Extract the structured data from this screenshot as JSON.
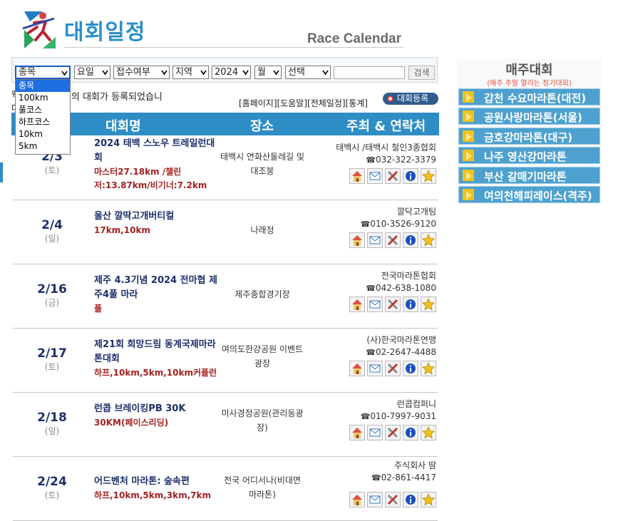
{
  "header": {
    "title": "대회일정",
    "subtitle": "Race Calendar"
  },
  "search": {
    "selects": {
      "event": "종목",
      "day": "요일",
      "registration": "접수여부",
      "region": "지역",
      "year": "2024",
      "month": "월",
      "pick": "선택"
    },
    "input_value": "",
    "button": "검색",
    "dropdown_options": [
      "종목",
      "100km",
      "풀코스",
      "하프코스",
      "10km",
      "5km"
    ]
  },
  "notice": {
    "left1": "웨",
    "left2": "다",
    "text": "의 대회가 등록되었습니"
  },
  "links": {
    "home": "[홈페이지]",
    "help": "[도움말]",
    "all": "[전체일정]",
    "stats": "[통계]",
    "register": "대회등록"
  },
  "table": {
    "headers": {
      "date": "",
      "name": "대회명",
      "place": "장소",
      "host": "주최 & 연락처"
    },
    "rows": [
      {
        "date": "2/3",
        "dow": "(토)",
        "name": "2024 태백 스노우 트레일런대회",
        "distance": "마스터27.18km /챌린저:13.87km/비기너:7.2km",
        "place": "태백시 연화산둘레길 및 대조붕",
        "org": "태백시 /태백시 철인3종협회",
        "tel": "032-322-3379"
      },
      {
        "date": "2/4",
        "dow": "(일)",
        "name": "울산 깔딱고개버티컬",
        "distance": "17km,10km",
        "place": "나래정",
        "org": "깔닥고개팀",
        "tel": "010-3526-9120"
      },
      {
        "date": "2/16",
        "dow": "(금)",
        "name": "제주 4.3기념 2024 전마협 제주4풀 마라",
        "distance": "풀",
        "place": "제주종합경기장",
        "org": "전국마라톤협회",
        "tel": "042-638-1080"
      },
      {
        "date": "2/17",
        "dow": "(토)",
        "name": "제21회 희망드림 동계국제마라톤대회",
        "distance": "하프,10km,5km,10km커플런",
        "place": "여의도한강공원 이벤트광장",
        "org": "(사)한국마라톤연맹",
        "tel": "02-2647-4488"
      },
      {
        "date": "2/18",
        "dow": "(일)",
        "name": "런콥 브레이킹PB 30K",
        "distance": "30KM(페이스리딩)",
        "place": "미사경정공원(관리동광장)",
        "org": "런콥컴퍼니",
        "tel": "010-7997-9031"
      },
      {
        "date": "2/24",
        "dow": "(토)",
        "name": "어드벤처 마라톤: 숲속편",
        "distance": "하프,10km,5km,3km,7km",
        "place": "전국 어디서나(비대면 마라톤)",
        "org": "주식회사 땀",
        "tel": "02-861-4417"
      }
    ],
    "icon_names": [
      "home-icon",
      "mail-icon",
      "tools-icon",
      "info-icon",
      "star-icon"
    ]
  },
  "weekly": {
    "title": "매주대회",
    "subtitle": "(매주 주말 열리는 정기대회)",
    "items": [
      "갑천 수요마라톤(대전)",
      "공원사랑마라톤(서울)",
      "금호강마라톤(대구)",
      "나주 영산강마라톤",
      "부산 갈매기마라톤",
      "여의천헤피레이스(격주)"
    ]
  },
  "colors": {
    "brand_blue": "#2e8dc5",
    "date_navy": "#1d2f6b",
    "distance_red": "#a52121",
    "weekly_blue": "#4ea1cf",
    "weekly_subtitle": "#e0503a"
  }
}
